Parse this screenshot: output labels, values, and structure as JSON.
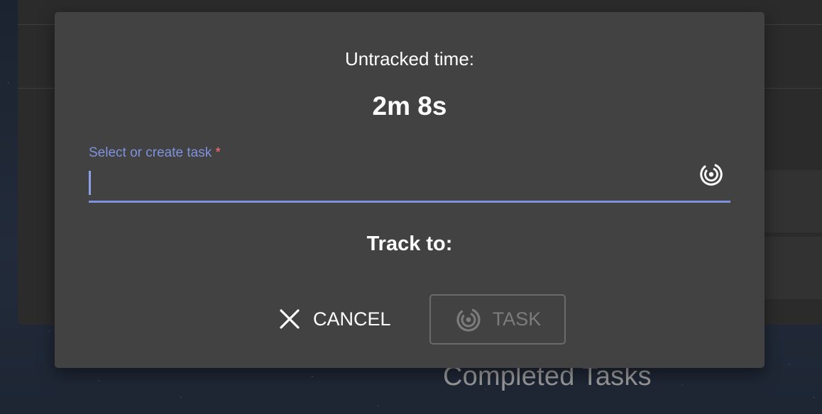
{
  "dialog": {
    "untracked_label": "Untracked time:",
    "untracked_value": "2m 8s",
    "task_field": {
      "label": "Select or create task",
      "required_mark": "*",
      "value": "",
      "icon": "track-target-icon"
    },
    "track_to_label": "Track to:",
    "buttons": {
      "cancel_label": "CANCEL",
      "cancel_icon": "close-icon",
      "task_label": "TASK",
      "task_icon": "track-target-icon",
      "task_disabled": true
    }
  },
  "background": {
    "completed_tasks_label": "Completed Tasks"
  },
  "colors": {
    "accent": "#7e93dd",
    "required": "#ff6f7d",
    "dialog_bg": "#424242",
    "disabled_text": "#7c7c7c"
  }
}
